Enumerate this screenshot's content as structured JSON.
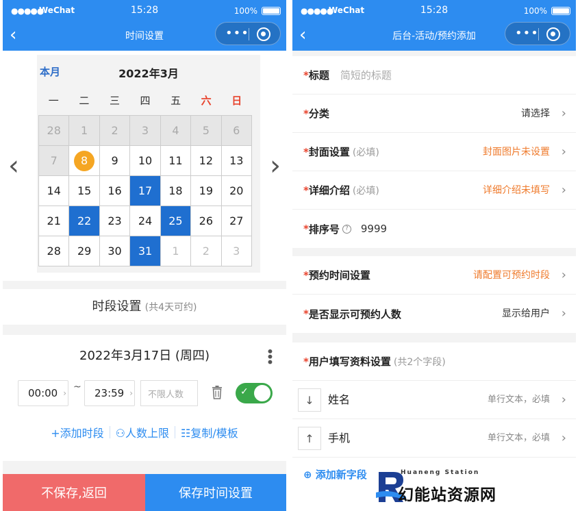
{
  "status": {
    "carrier": "WeChat",
    "time": "15:28",
    "battery": "100%"
  },
  "left": {
    "nav_title": "时间设置",
    "calendar": {
      "month_button": "本月",
      "title": "2022年3月",
      "weekdays": [
        "一",
        "二",
        "三",
        "四",
        "五",
        "六",
        "日"
      ],
      "weeks": [
        [
          {
            "d": "28",
            "t": "other"
          },
          {
            "d": "1",
            "t": "past"
          },
          {
            "d": "2",
            "t": "past"
          },
          {
            "d": "3",
            "t": "past"
          },
          {
            "d": "4",
            "t": "past"
          },
          {
            "d": "5",
            "t": "past"
          },
          {
            "d": "6",
            "t": "past"
          }
        ],
        [
          {
            "d": "7",
            "t": "past"
          },
          {
            "d": "8",
            "t": "today"
          },
          {
            "d": "9",
            "t": ""
          },
          {
            "d": "10",
            "t": ""
          },
          {
            "d": "11",
            "t": ""
          },
          {
            "d": "12",
            "t": ""
          },
          {
            "d": "13",
            "t": ""
          }
        ],
        [
          {
            "d": "14",
            "t": ""
          },
          {
            "d": "15",
            "t": ""
          },
          {
            "d": "16",
            "t": ""
          },
          {
            "d": "17",
            "t": "sel"
          },
          {
            "d": "18",
            "t": ""
          },
          {
            "d": "19",
            "t": ""
          },
          {
            "d": "20",
            "t": ""
          }
        ],
        [
          {
            "d": "21",
            "t": ""
          },
          {
            "d": "22",
            "t": "sel"
          },
          {
            "d": "23",
            "t": ""
          },
          {
            "d": "24",
            "t": ""
          },
          {
            "d": "25",
            "t": "sel"
          },
          {
            "d": "26",
            "t": ""
          },
          {
            "d": "27",
            "t": ""
          }
        ],
        [
          {
            "d": "28",
            "t": ""
          },
          {
            "d": "29",
            "t": ""
          },
          {
            "d": "30",
            "t": ""
          },
          {
            "d": "31",
            "t": "sel"
          },
          {
            "d": "1",
            "t": "next"
          },
          {
            "d": "2",
            "t": "next"
          },
          {
            "d": "3",
            "t": "next"
          }
        ]
      ]
    },
    "period": {
      "title": "时段设置",
      "sub": "(共4天可约)"
    },
    "slot": {
      "date": "2022年3月17日 (周四)",
      "start": "00:00",
      "end": "23:59",
      "tilde": "~",
      "limit_placeholder": "不限人数",
      "enabled": true,
      "actions": [
        "+添加时段",
        "人数上限",
        "复制/模板"
      ]
    },
    "buttons": {
      "cancel": "不保存,返回",
      "save": "保存时间设置"
    }
  },
  "right": {
    "nav_title": "后台-活动/预约添加",
    "group1": {
      "title_label": "标题",
      "title_placeholder": "简短的标题",
      "category_label": "分类",
      "category_value": "请选择",
      "cover_label": "封面设置",
      "cover_hint": "(必填)",
      "cover_value": "封面图片未设置",
      "detail_label": "详细介绍",
      "detail_hint": "(必填)",
      "detail_value": "详细介绍未填写",
      "order_label": "排序号",
      "order_value": "9999"
    },
    "group2": {
      "time_label": "预约时间设置",
      "time_value": "请配置可预约时段",
      "show_label": "是否显示可预约人数",
      "show_value": "显示给用户"
    },
    "group3": {
      "title": "用户填写资料设置",
      "hint": "(共2个字段)",
      "fields": [
        {
          "name": "姓名",
          "meta": "单行文本，必填",
          "arrow": "↓"
        },
        {
          "name": "手机",
          "meta": "单行文本，必填",
          "arrow": "↑"
        }
      ],
      "add_label": "添加新字段"
    }
  },
  "logo": {
    "sub": "Huaneng Station",
    "main": "幻能站资源网"
  },
  "colors": {
    "primary": "#2d8cf0",
    "danger": "#f06a6a",
    "warn": "#ef7b2d",
    "selected": "#1f6fd0",
    "today": "#f5a623",
    "toggle": "#3aa84a"
  }
}
